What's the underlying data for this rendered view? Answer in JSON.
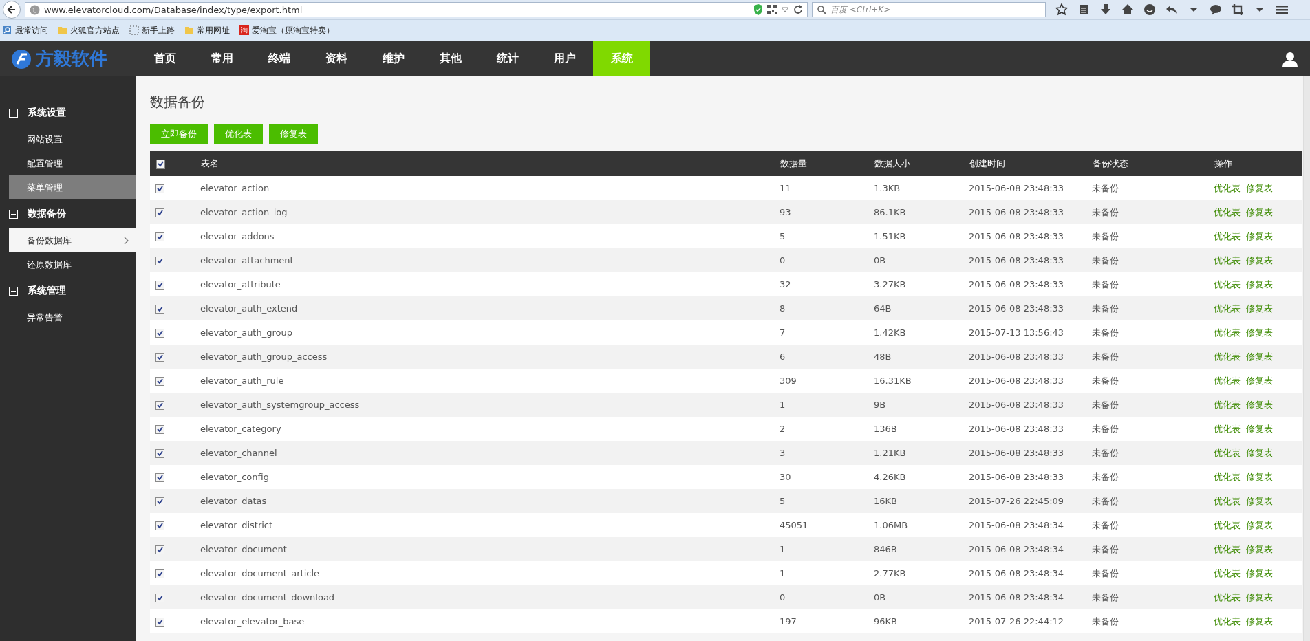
{
  "browser": {
    "url": "www.elevatorcloud.com/Database/index/type/export.html",
    "search_placeholder": "百度 <Ctrl+K>",
    "bookmarks": [
      {
        "label": "最常访问",
        "kind": "search"
      },
      {
        "label": "火狐官方站点",
        "kind": "folder"
      },
      {
        "label": "新手上路",
        "kind": "dashed"
      },
      {
        "label": "常用网址",
        "kind": "folder"
      },
      {
        "label": "爱淘宝（原淘宝特卖）",
        "kind": "taobao",
        "badge": "淘"
      }
    ]
  },
  "header": {
    "logo": "方毅软件",
    "nav": [
      {
        "label": "首页",
        "selected": false
      },
      {
        "label": "常用",
        "selected": false
      },
      {
        "label": "终端",
        "selected": false
      },
      {
        "label": "资料",
        "selected": false
      },
      {
        "label": "维护",
        "selected": false
      },
      {
        "label": "其他",
        "selected": false
      },
      {
        "label": "统计",
        "selected": false
      },
      {
        "label": "用户",
        "selected": false
      },
      {
        "label": "系统",
        "selected": true
      }
    ]
  },
  "sidebar": [
    {
      "label": "系统设置",
      "expanded": true,
      "children": [
        {
          "label": "网站设置",
          "selected": false,
          "hover": false
        },
        {
          "label": "配置管理",
          "selected": false,
          "hover": false
        },
        {
          "label": "菜单管理",
          "selected": false,
          "hover": true
        }
      ]
    },
    {
      "label": "数据备份",
      "expanded": true,
      "children": [
        {
          "label": "备份数据库",
          "selected": true,
          "hover": false
        },
        {
          "label": "还原数据库",
          "selected": false,
          "hover": false
        }
      ]
    },
    {
      "label": "系统管理",
      "expanded": true,
      "children": [
        {
          "label": "异常告警",
          "selected": false,
          "hover": false
        }
      ]
    }
  ],
  "page_title": "数据备份",
  "buttons": [
    "立即备份",
    "优化表",
    "修复表"
  ],
  "table": {
    "all_checked": true,
    "columns": [
      "表名",
      "数据量",
      "数据大小",
      "创建时间",
      "备份状态",
      "操作"
    ],
    "rows": [
      {
        "checked": true,
        "name": "elevator_action",
        "count": "11",
        "size": "1.3KB",
        "created": "2015-06-08 23:48:33",
        "status": "未备份",
        "actions": [
          "优化表",
          "修复表"
        ]
      },
      {
        "checked": true,
        "name": "elevator_action_log",
        "count": "93",
        "size": "86.1KB",
        "created": "2015-06-08 23:48:33",
        "status": "未备份",
        "actions": [
          "优化表",
          "修复表"
        ]
      },
      {
        "checked": true,
        "name": "elevator_addons",
        "count": "5",
        "size": "1.51KB",
        "created": "2015-06-08 23:48:33",
        "status": "未备份",
        "actions": [
          "优化表",
          "修复表"
        ]
      },
      {
        "checked": true,
        "name": "elevator_attachment",
        "count": "0",
        "size": "0B",
        "created": "2015-06-08 23:48:33",
        "status": "未备份",
        "actions": [
          "优化表",
          "修复表"
        ]
      },
      {
        "checked": true,
        "name": "elevator_attribute",
        "count": "32",
        "size": "3.27KB",
        "created": "2015-06-08 23:48:33",
        "status": "未备份",
        "actions": [
          "优化表",
          "修复表"
        ]
      },
      {
        "checked": true,
        "name": "elevator_auth_extend",
        "count": "8",
        "size": "64B",
        "created": "2015-06-08 23:48:33",
        "status": "未备份",
        "actions": [
          "优化表",
          "修复表"
        ]
      },
      {
        "checked": true,
        "name": "elevator_auth_group",
        "count": "7",
        "size": "1.42KB",
        "created": "2015-07-13 13:56:43",
        "status": "未备份",
        "actions": [
          "优化表",
          "修复表"
        ]
      },
      {
        "checked": true,
        "name": "elevator_auth_group_access",
        "count": "6",
        "size": "48B",
        "created": "2015-06-08 23:48:33",
        "status": "未备份",
        "actions": [
          "优化表",
          "修复表"
        ]
      },
      {
        "checked": true,
        "name": "elevator_auth_rule",
        "count": "309",
        "size": "16.31KB",
        "created": "2015-06-08 23:48:33",
        "status": "未备份",
        "actions": [
          "优化表",
          "修复表"
        ]
      },
      {
        "checked": true,
        "name": "elevator_auth_systemgroup_access",
        "count": "1",
        "size": "9B",
        "created": "2015-06-08 23:48:33",
        "status": "未备份",
        "actions": [
          "优化表",
          "修复表"
        ]
      },
      {
        "checked": true,
        "name": "elevator_category",
        "count": "2",
        "size": "136B",
        "created": "2015-06-08 23:48:33",
        "status": "未备份",
        "actions": [
          "优化表",
          "修复表"
        ]
      },
      {
        "checked": true,
        "name": "elevator_channel",
        "count": "3",
        "size": "1.21KB",
        "created": "2015-06-08 23:48:33",
        "status": "未备份",
        "actions": [
          "优化表",
          "修复表"
        ]
      },
      {
        "checked": true,
        "name": "elevator_config",
        "count": "30",
        "size": "4.26KB",
        "created": "2015-06-08 23:48:33",
        "status": "未备份",
        "actions": [
          "优化表",
          "修复表"
        ]
      },
      {
        "checked": true,
        "name": "elevator_datas",
        "count": "5",
        "size": "16KB",
        "created": "2015-07-26 22:45:09",
        "status": "未备份",
        "actions": [
          "优化表",
          "修复表"
        ]
      },
      {
        "checked": true,
        "name": "elevator_district",
        "count": "45051",
        "size": "1.06MB",
        "created": "2015-06-08 23:48:34",
        "status": "未备份",
        "actions": [
          "优化表",
          "修复表"
        ]
      },
      {
        "checked": true,
        "name": "elevator_document",
        "count": "1",
        "size": "846B",
        "created": "2015-06-08 23:48:34",
        "status": "未备份",
        "actions": [
          "优化表",
          "修复表"
        ]
      },
      {
        "checked": true,
        "name": "elevator_document_article",
        "count": "1",
        "size": "2.77KB",
        "created": "2015-06-08 23:48:34",
        "status": "未备份",
        "actions": [
          "优化表",
          "修复表"
        ]
      },
      {
        "checked": true,
        "name": "elevator_document_download",
        "count": "0",
        "size": "0B",
        "created": "2015-06-08 23:48:34",
        "status": "未备份",
        "actions": [
          "优化表",
          "修复表"
        ]
      },
      {
        "checked": true,
        "name": "elevator_elevator_base",
        "count": "197",
        "size": "96KB",
        "created": "2015-07-26 22:44:12",
        "status": "未备份",
        "actions": [
          "优化表",
          "修复表"
        ]
      }
    ]
  }
}
